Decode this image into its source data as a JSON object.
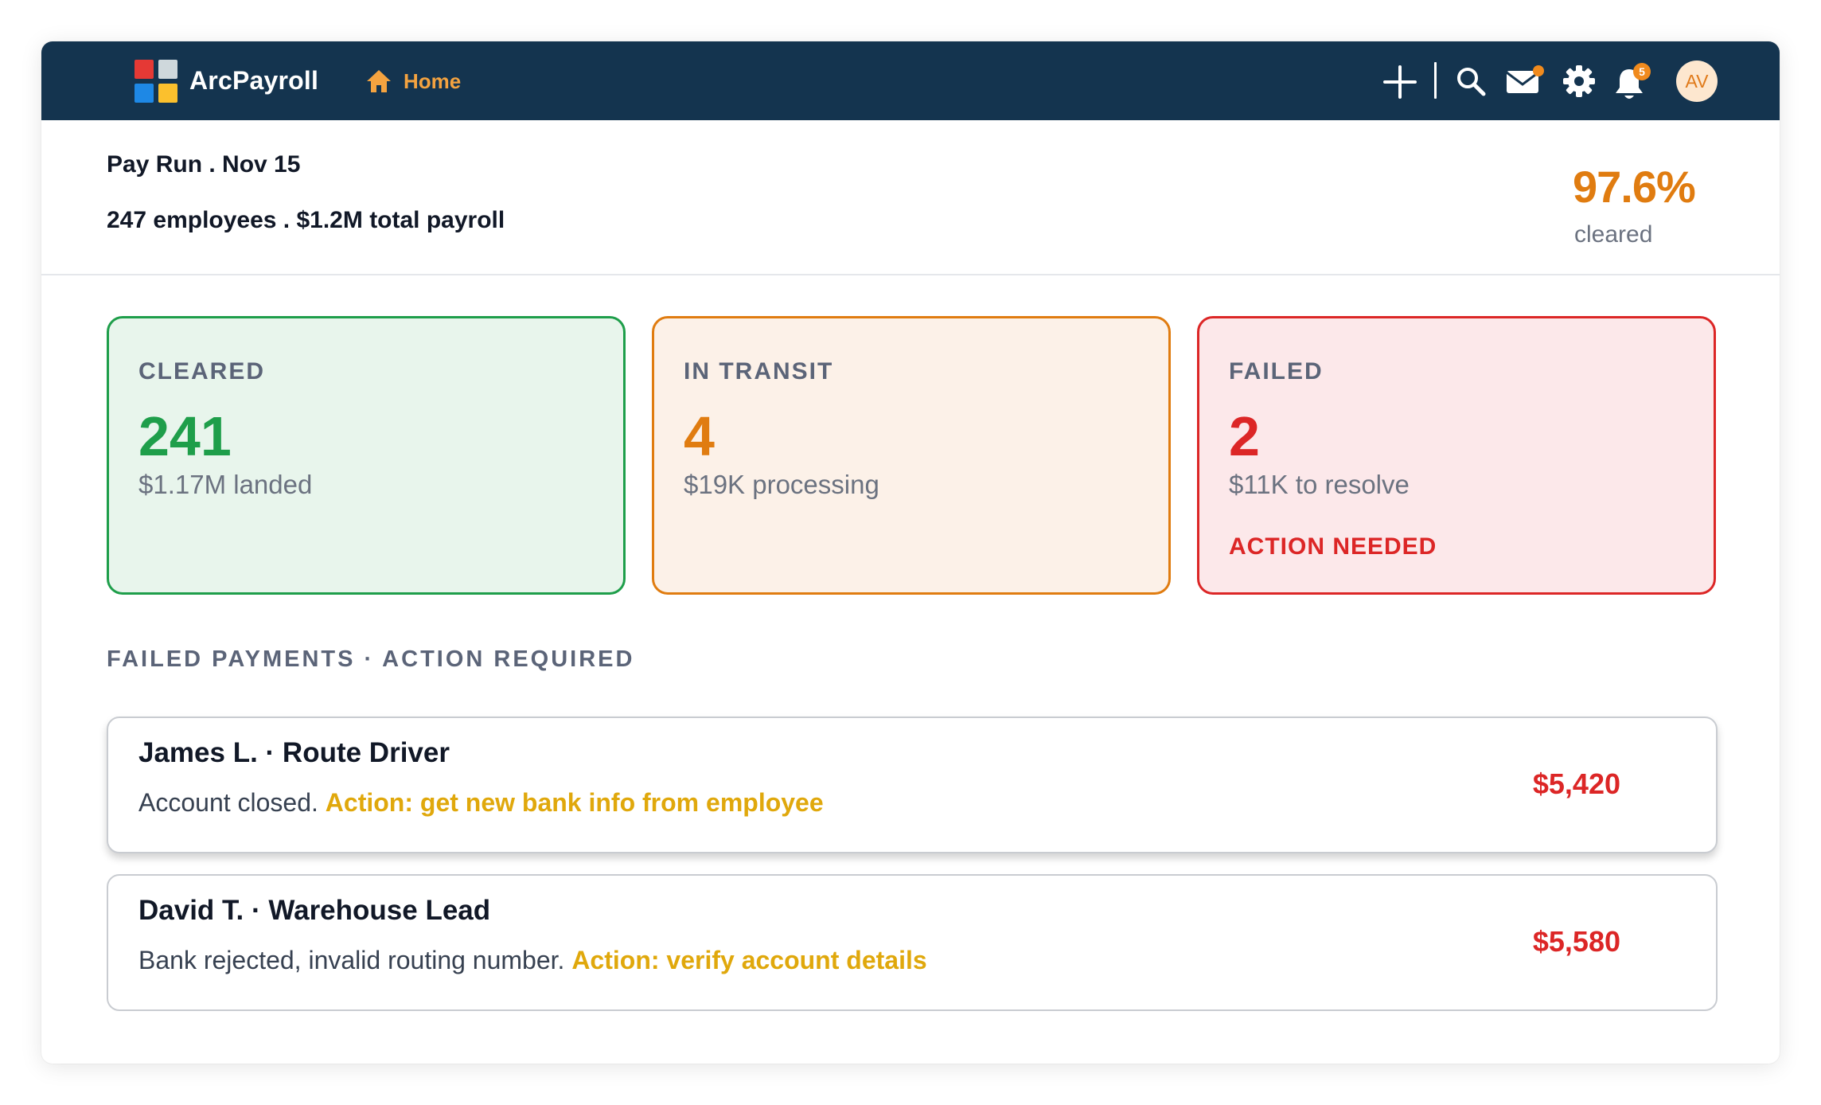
{
  "app": {
    "brand": "ArcPayroll",
    "home_label": "Home",
    "notification_count": "5",
    "avatar_initials": "AV",
    "colors": {
      "topbar": "#14344f",
      "accent_orange": "#f4a340",
      "logo": [
        "#e53935",
        "#cfd8dc",
        "#1e88e5",
        "#fbc02d"
      ]
    },
    "icons": [
      "plus-icon",
      "search-icon",
      "mail-icon",
      "gear-icon",
      "bell-icon",
      "home-icon"
    ]
  },
  "summary": {
    "title": "Pay Run . Nov 15",
    "subtitle": "247 employees . $1.2M total payroll",
    "cleared_pct": "97.6%",
    "cleared_label": "cleared"
  },
  "cards": [
    {
      "label": "CLEARED",
      "value": "241",
      "detail": "$1.17M landed",
      "color": "#1e9e4a",
      "bg": "#e8f5ec"
    },
    {
      "label": "IN TRANSIT",
      "value": "4",
      "detail": "$19K processing",
      "color": "#e07c10",
      "bg": "#fcf1e8"
    },
    {
      "label": "FAILED",
      "value": "2",
      "detail": "$11K to resolve",
      "action": "ACTION NEEDED",
      "color": "#dc2626",
      "bg": "#fce8ea"
    }
  ],
  "failed": {
    "section_title": "FAILED PAYMENTS · ACTION REQUIRED",
    "rows": [
      {
        "name": "James L. · Route Driver",
        "reason": "Account closed.",
        "action": "Action: get new bank info from employee",
        "amount": "$5,420"
      },
      {
        "name": "David T. · Warehouse Lead",
        "reason": "Bank rejected, invalid routing number.",
        "action": "Action: verify account details",
        "amount": "$5,580"
      }
    ]
  }
}
